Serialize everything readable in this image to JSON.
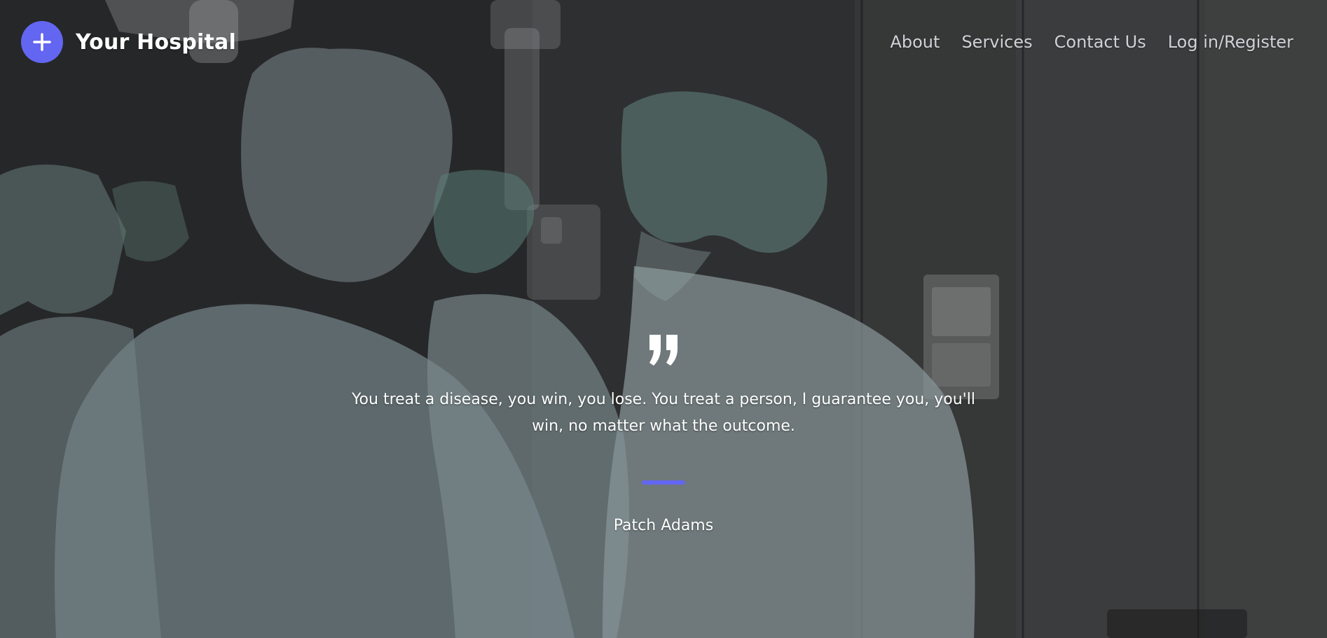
{
  "brand": {
    "title": "Your Hospital",
    "icon": "plus-icon",
    "accent_color": "#6366f1"
  },
  "nav": {
    "items": [
      {
        "label": "About"
      },
      {
        "label": "Services"
      },
      {
        "label": "Contact Us"
      },
      {
        "label": "Log in/Register"
      }
    ]
  },
  "testimonial": {
    "quote_icon": "quote-icon",
    "text": "You treat a disease, you win, you lose. You treat a person, I guarantee you, you'll win, no matter what the outcome.",
    "author": "Patch Adams"
  },
  "background": {
    "icon": "surgeons-photo"
  }
}
